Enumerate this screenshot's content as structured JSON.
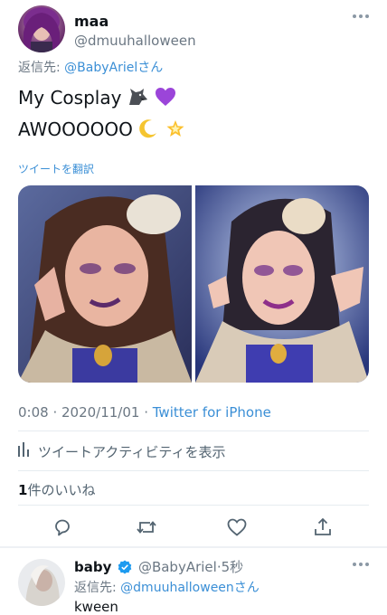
{
  "tweet": {
    "author_name": "maa",
    "author_handle": "@dmuuhalloween",
    "reply_prefix": "返信先: ",
    "reply_handle": "@BabyAriel",
    "reply_suffix": "さん",
    "text_line1": "My Cosplay",
    "text_line2": "AWOOOOOO",
    "translate_label": "ツイートを翻訳",
    "time": "0:08 · 2020/11/01 · ",
    "source": "Twitter for iPhone",
    "activity_label": "ツイートアクティビティを表示",
    "like_count": "1",
    "like_label": "件のいいね"
  },
  "icons": [
    "more-icon",
    "wolf-emoji-icon",
    "purple-heart-emoji-icon",
    "crescent-moon-emoji-icon",
    "glowing-star-emoji-icon",
    "bar-chart-icon",
    "reply-icon",
    "retweet-icon",
    "like-icon",
    "share-icon",
    "verified-icon"
  ],
  "colors": {
    "link": "#3b8fd6",
    "secondary": "#6b7783",
    "verified": "#1d9bf0"
  },
  "reply": {
    "author_name": "baby",
    "author_handle": "@BabyAriel",
    "time": "·5秒",
    "reply_prefix": "返信先: ",
    "reply_handle": "@dmuuhalloween",
    "reply_suffix": "さん",
    "text": "kween"
  }
}
